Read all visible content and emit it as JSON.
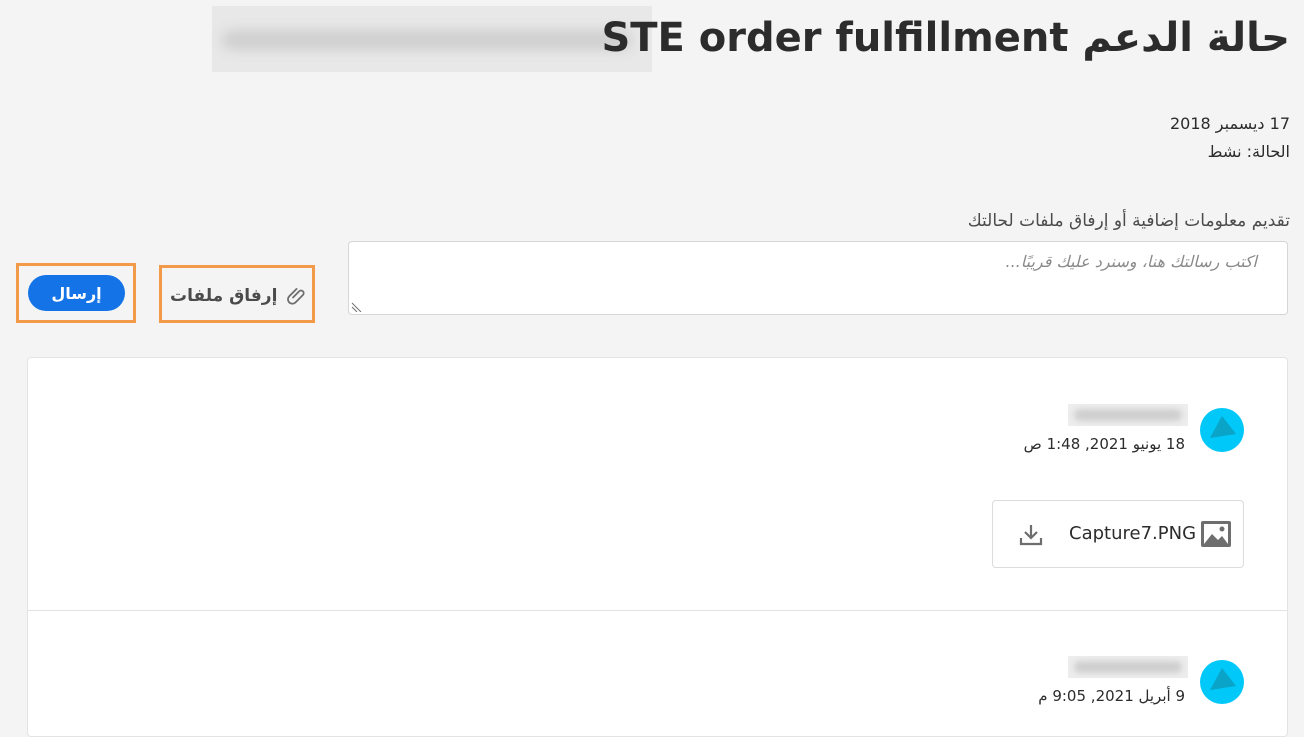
{
  "header": {
    "title": "حالة الدعم STE order fulfillment",
    "date": "17 ديسمبر 2018",
    "status": "الحالة: نشط"
  },
  "compose": {
    "label": "تقديم معلومات إضافية أو إرفاق ملفات لحالتك",
    "placeholder": "اكتب رسالتك هنا، وسنرد عليك قريبًا...",
    "value": "",
    "attach_label": "إرفاق ملفات",
    "send_label": "إرسال"
  },
  "thread": {
    "messages": [
      {
        "timestamp": "18 يونيو 2021, 1:48 ص",
        "attachment": {
          "file_name": "Capture7.PNG",
          "icon": "image-icon",
          "action_icon": "download-icon"
        }
      },
      {
        "timestamp": "9 أبريل 2021, 9:05 م"
      }
    ]
  },
  "colors": {
    "accent": "#1473e6",
    "highlight": "#f29a4a",
    "avatar": "#00c8f8",
    "background": "#f4f4f4"
  }
}
